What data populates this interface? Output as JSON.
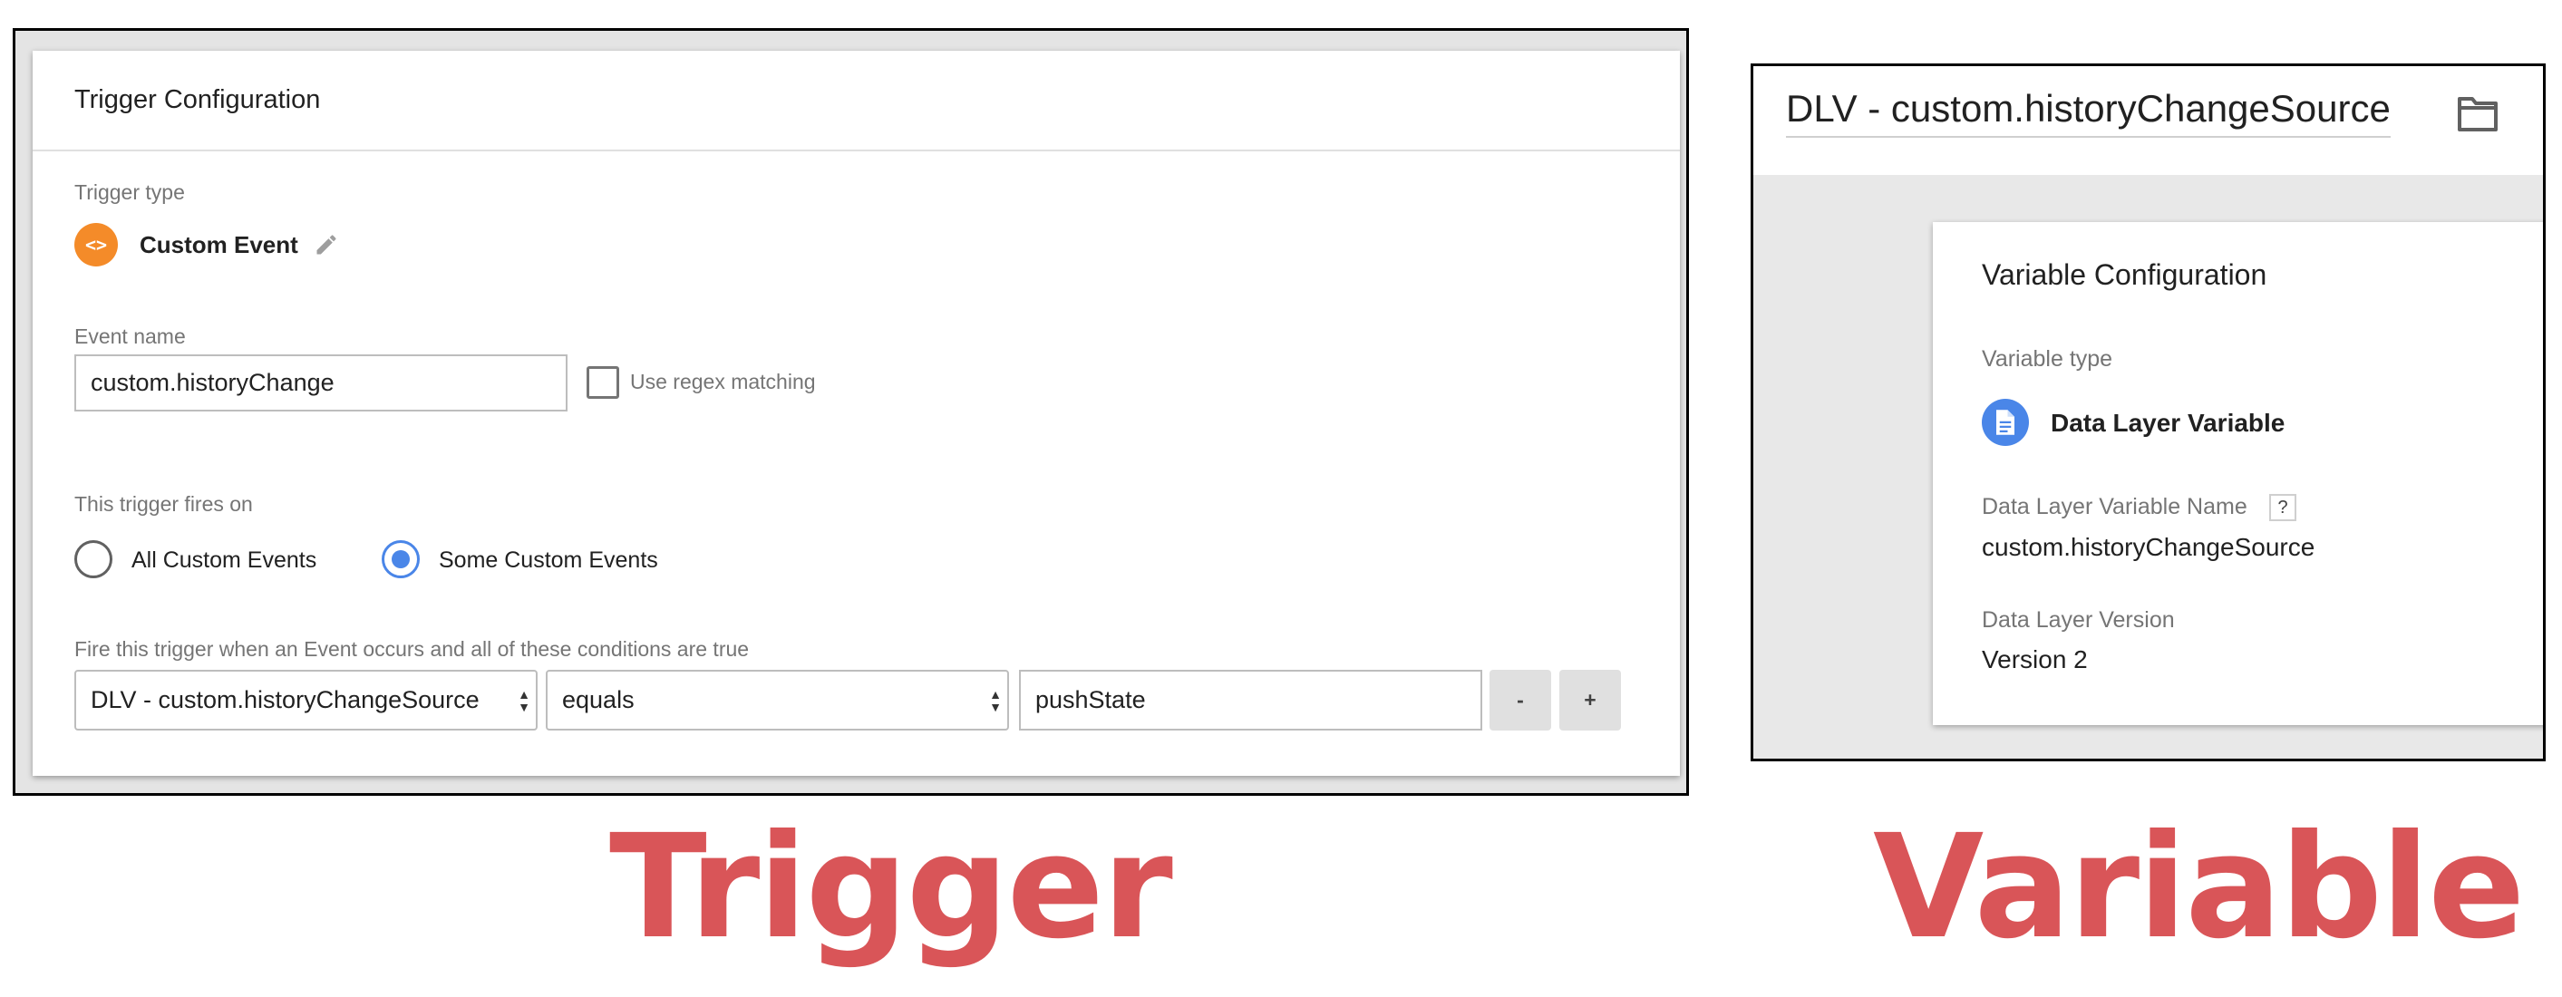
{
  "trigger_panel": {
    "card_title": "Trigger Configuration",
    "trigger_type_label": "Trigger type",
    "trigger_type_icon": "custom-event-code-icon",
    "trigger_type_glyph": "<>",
    "trigger_type_name": "Custom Event",
    "event_name_label": "Event name",
    "event_name_value": "custom.historyChange",
    "regex_label": "Use regex matching",
    "regex_checked": false,
    "fires_on_label": "This trigger fires on",
    "fires_on_options": [
      {
        "label": "All Custom Events",
        "selected": false
      },
      {
        "label": "Some Custom Events",
        "selected": true
      }
    ],
    "condition_label": "Fire this trigger when an Event occurs and all of these conditions are true",
    "condition": {
      "variable": "DLV - custom.historyChangeSource",
      "operator": "equals",
      "value": "pushState"
    },
    "remove_button": "-",
    "add_button": "+"
  },
  "variable_panel": {
    "variable_name": "DLV - custom.historyChangeSource",
    "card_title": "Variable Configuration",
    "variable_type_label": "Variable type",
    "variable_type_icon": "document-icon",
    "variable_type_name": "Data Layer Variable",
    "dlv_name_label": "Data Layer Variable Name",
    "help_glyph": "?",
    "dlv_name_value": "custom.historyChangeSource",
    "dlv_version_label": "Data Layer Version",
    "dlv_version_value": "Version 2"
  },
  "captions": {
    "left": "Trigger",
    "right": "Variable"
  },
  "colors": {
    "caption": "#d95558",
    "trigger_icon": "#f48b29",
    "variable_icon": "#4a86e8",
    "radio_selected": "#4a86e8"
  }
}
